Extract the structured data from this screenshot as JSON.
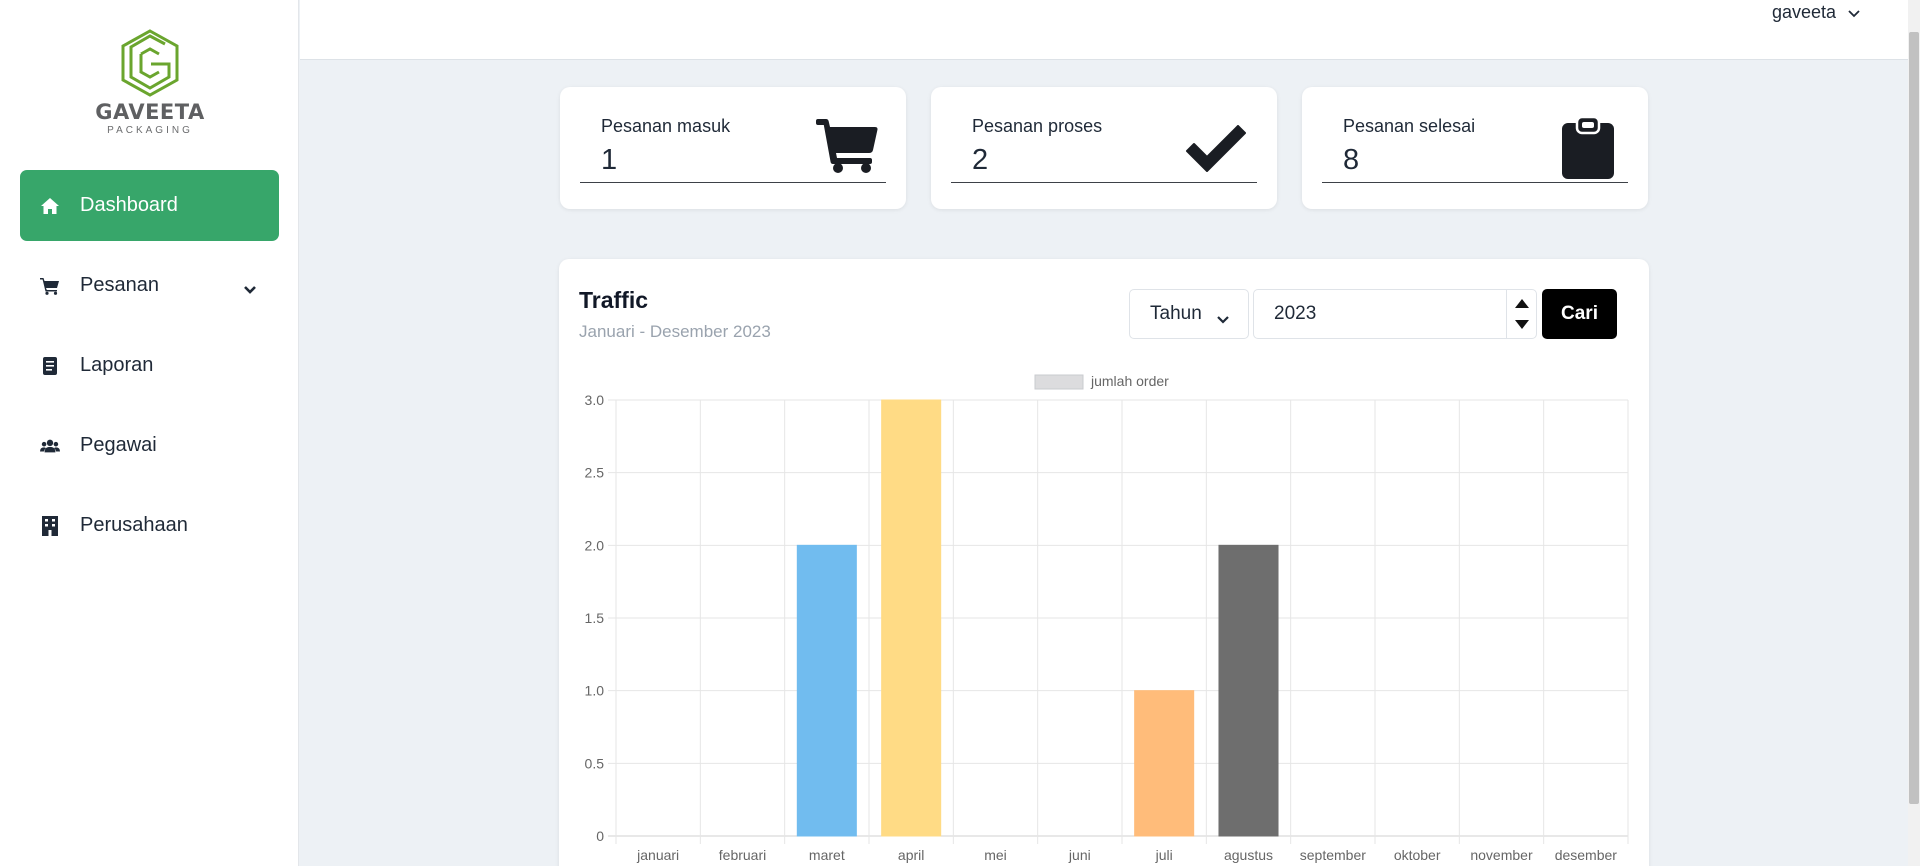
{
  "brand": {
    "name": "GAVEETA",
    "tagline": "PACKAGING"
  },
  "sidebar": {
    "items": [
      {
        "label": "Dashboard",
        "icon": "home-icon",
        "active": true
      },
      {
        "label": "Pesanan",
        "icon": "cart-icon",
        "has_submenu": true
      },
      {
        "label": "Laporan",
        "icon": "document-icon"
      },
      {
        "label": "Pegawai",
        "icon": "users-icon"
      },
      {
        "label": "Perusahaan",
        "icon": "building-icon"
      }
    ]
  },
  "topbar": {
    "username": "gaveeta"
  },
  "stats": [
    {
      "label": "Pesanan masuk",
      "value": "1",
      "icon": "cart-icon"
    },
    {
      "label": "Pesanan proses",
      "value": "2",
      "icon": "check-icon"
    },
    {
      "label": "Pesanan selesai",
      "value": "8",
      "icon": "clipboard-icon"
    }
  ],
  "traffic": {
    "title": "Traffic",
    "subtitle": "Januari - Desember 2023",
    "filter_select": "Tahun",
    "year_value": "2023",
    "search_button": "Cari"
  },
  "colors": {
    "accent": "#37a66a",
    "background": "#edf1f5"
  },
  "chart_data": {
    "type": "bar",
    "categories": [
      "januari",
      "februari",
      "maret",
      "april",
      "mei",
      "juni",
      "juli",
      "agustus",
      "september",
      "oktober",
      "november",
      "desember"
    ],
    "series": [
      {
        "name": "jumlah order",
        "values": [
          0,
          0,
          2,
          3,
          0,
          0,
          1,
          2,
          0,
          0,
          0,
          0
        ]
      }
    ],
    "bar_colors": [
      "#c9cbcf",
      "#c9cbcf",
      "#71bcef",
      "#ffdb85",
      "#c9cbcf",
      "#c9cbcf",
      "#ffbc7a",
      "#6e6e6e",
      "#c9cbcf",
      "#c9cbcf",
      "#c9cbcf",
      "#c9cbcf"
    ],
    "ylim": [
      0,
      3
    ],
    "yticks": [
      "0",
      "0.5",
      "1.0",
      "1.5",
      "2.0",
      "2.5",
      "3.0"
    ],
    "legend_position": "top",
    "grid": true
  }
}
